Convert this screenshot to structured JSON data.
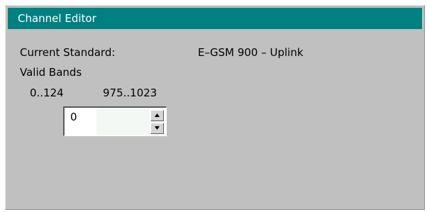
{
  "window": {
    "title": "Channel Editor"
  },
  "standard": {
    "label": "Current Standard:",
    "value": "E–GSM 900 – Uplink"
  },
  "bands": {
    "label": "Valid Bands",
    "ranges": [
      "0..124",
      "975..1023"
    ]
  },
  "channel": {
    "value": "0",
    "increment_icon": "arrow-up-icon",
    "decrement_icon": "arrow-down-icon"
  },
  "colors": {
    "titlebar": "#008080",
    "background": "#c0c0c0"
  }
}
